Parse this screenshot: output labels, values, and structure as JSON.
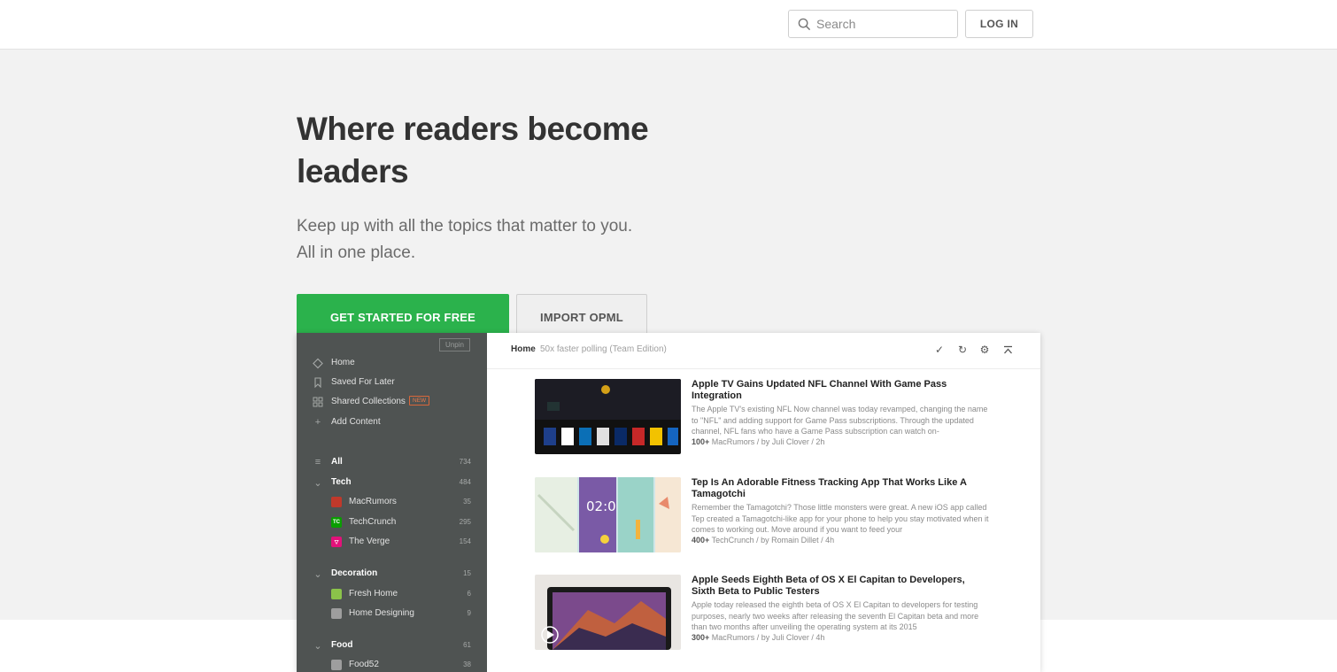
{
  "header": {
    "search_placeholder": "Search",
    "login_label": "LOG IN"
  },
  "hero": {
    "headline": "Where readers become leaders",
    "subtitle_line1": "Keep up with all the topics that matter to you.",
    "subtitle_line2": "All in one place.",
    "primary_cta": "GET STARTED FOR FREE",
    "secondary_cta": "IMPORT OPML",
    "accent_color": "#2bb24c"
  },
  "preview": {
    "unpin_label": "Unpin",
    "nav": [
      {
        "label": "Home",
        "icon": "home-icon"
      },
      {
        "label": "Saved For Later",
        "icon": "bookmark-icon"
      },
      {
        "label": "Shared Collections",
        "icon": "collections-icon",
        "badge": "NEW"
      },
      {
        "label": "Add Content",
        "icon": "plus-icon"
      }
    ],
    "all": {
      "label": "All",
      "count": "734"
    },
    "categories": [
      {
        "label": "Tech",
        "count": "484",
        "feeds": [
          {
            "label": "MacRumors",
            "count": "35",
            "icon_color": "#c0392b",
            "icon_text": ""
          },
          {
            "label": "TechCrunch",
            "count": "295",
            "icon_color": "#0a9e01",
            "icon_text": "TC"
          },
          {
            "label": "The Verge",
            "count": "154",
            "icon_color": "#e2127a",
            "icon_text": "▽"
          }
        ]
      },
      {
        "label": "Decoration",
        "count": "15",
        "feeds": [
          {
            "label": "Fresh Home",
            "count": "6",
            "icon_color": "#8bc34a",
            "icon_text": ""
          },
          {
            "label": "Home Designing",
            "count": "9",
            "icon_color": "#9e9e9e",
            "icon_text": ""
          }
        ]
      },
      {
        "label": "Food",
        "count": "61",
        "feeds": [
          {
            "label": "Food52",
            "count": "38",
            "icon_color": "#9e9e9e",
            "icon_text": ""
          }
        ]
      }
    ],
    "main_title": "Home",
    "main_subtitle": "50x faster polling (Team Edition)",
    "toolbar_icons": [
      "check-icon",
      "refresh-icon",
      "gear-icon",
      "collapse-icon"
    ],
    "articles": [
      {
        "title": "Apple TV Gains Updated NFL Channel With Game Pass Integration",
        "summary": "The Apple TV's existing NFL Now channel was today revamped, changing the name to \"NFL\" and adding support for Game Pass subscriptions. Through the updated channel, NFL fans who have a Game Pass subscription can watch on-",
        "popularity": "100+",
        "meta": "MacRumors / by Juli Clover / 2h"
      },
      {
        "title": "Tep Is An Adorable Fitness Tracking App That Works Like A Tamagotchi",
        "summary": "Remember the Tamagotchi? Those little monsters were great. A new iOS app called Tep created a Tamagotchi-like app for your phone to help you stay motivated when it comes to working out. Move around if you want to feed your",
        "popularity": "400+",
        "meta": "TechCrunch / by Romain Dillet / 4h"
      },
      {
        "title": "Apple Seeds Eighth Beta of OS X El Capitan to Developers, Sixth Beta to Public Testers",
        "summary": "Apple today released the eighth beta of OS X El Capitan to developers for testing purposes, nearly two weeks after releasing the seventh El Capitan beta and more than two months after unveiling the operating system at its 2015",
        "popularity": "300+",
        "meta": "MacRumors / by Juli Clover / 4h"
      }
    ],
    "thumb2_clock": "02:0"
  }
}
